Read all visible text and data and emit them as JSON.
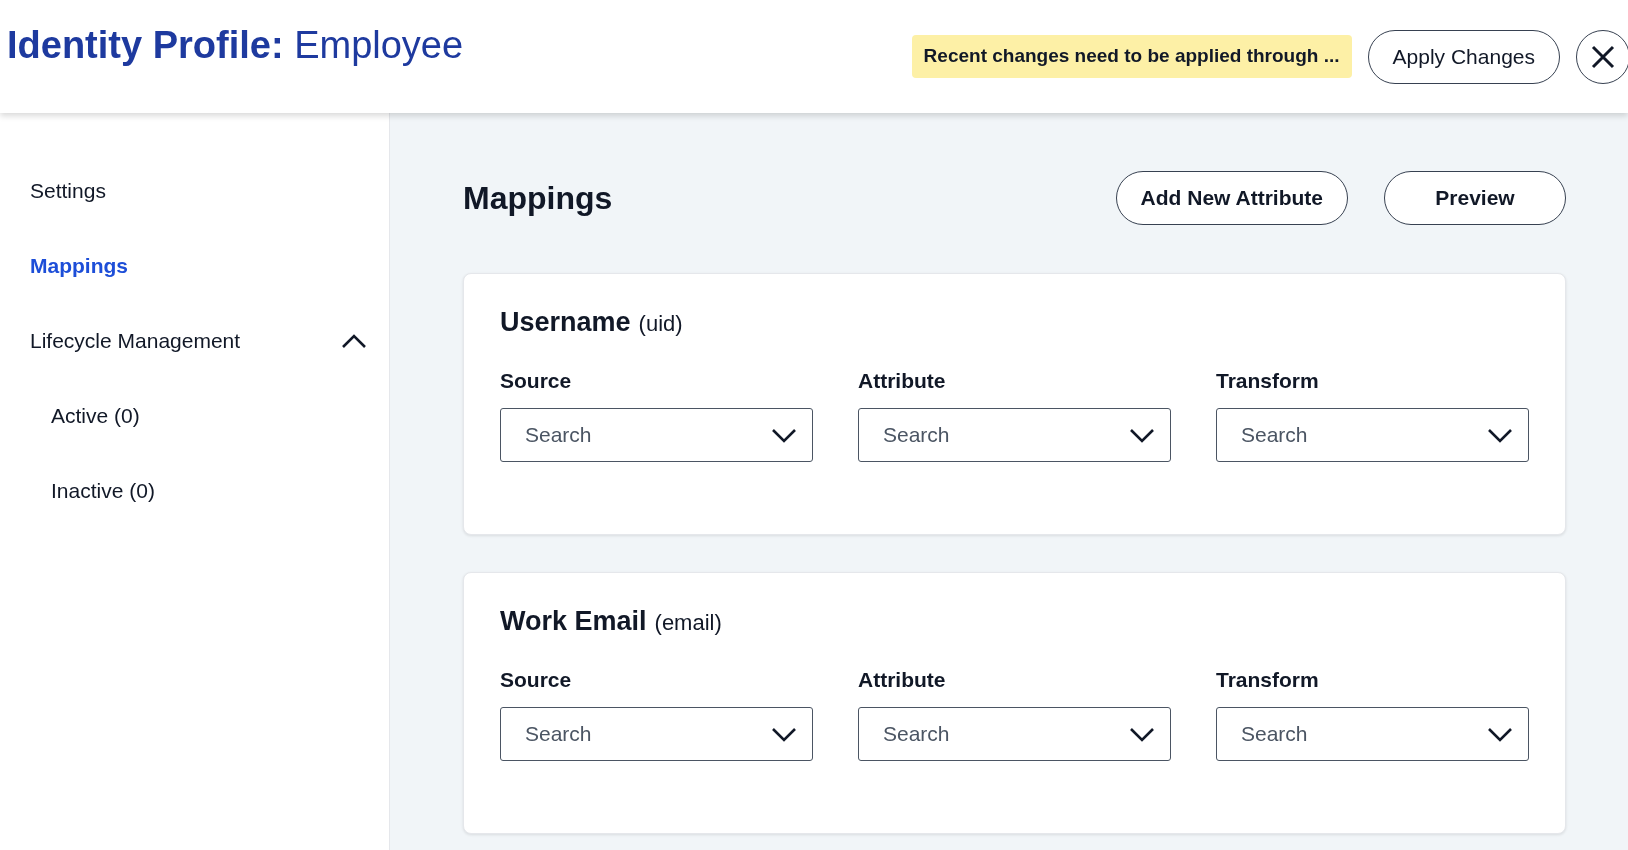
{
  "header": {
    "title": "**Identity Profile:** Employee",
    "notice": "Recent changes need to be applied through ...",
    "apply_button": "Apply Changes"
  },
  "sidebar": {
    "items": [
      {
        "label": "Settings",
        "selected": false
      },
      {
        "label": "Mappings",
        "selected": true
      },
      {
        "label": "Lifecycle Management",
        "selected": false,
        "expanded": true,
        "children": [
          {
            "label": "Active (0)",
            "selected": false
          },
          {
            "label": "Inactive (0)",
            "selected": false
          }
        ]
      }
    ]
  },
  "main": {
    "title": "Mappings",
    "buttons": [
      "Add New Attribute",
      "Preview"
    ],
    "cards": [
      {
        "name": "Username",
        "key": "(uid)",
        "fields": [
          {
            "label": "Source",
            "placeholder": "Search"
          },
          {
            "label": "Attribute",
            "placeholder": "Search"
          },
          {
            "label": "Transform",
            "placeholder": "Search"
          }
        ]
      },
      {
        "name": "Work Email",
        "key": "(email)",
        "fields": [
          {
            "label": "Source",
            "placeholder": "Search"
          },
          {
            "label": "Attribute",
            "placeholder": "Search"
          },
          {
            "label": "Transform",
            "placeholder": "Search"
          }
        ]
      }
    ]
  }
}
